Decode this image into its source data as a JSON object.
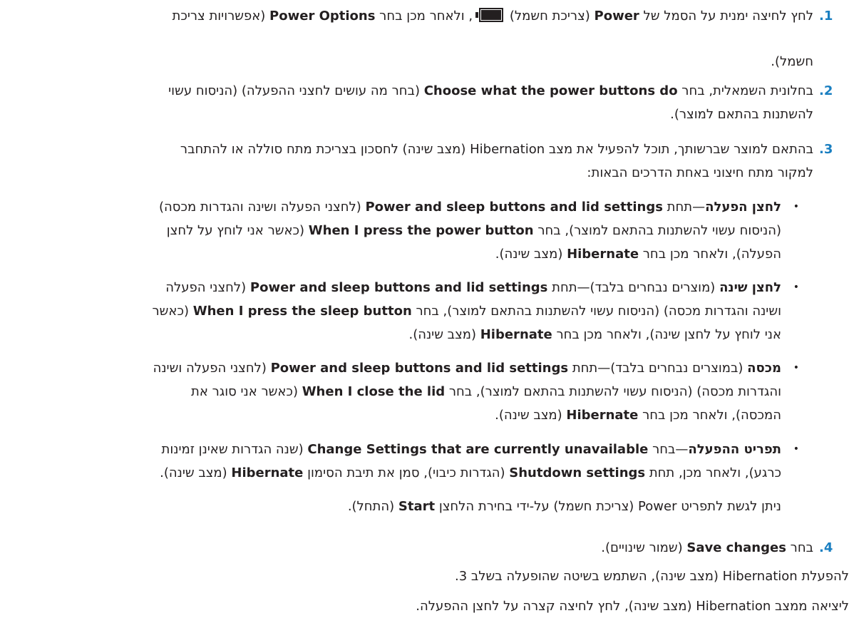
{
  "steps": [
    {
      "number": ".1",
      "lines": [
        {
          "parts": [
            "לחץ לחיצה ימנית על הסמל של ",
            "Power",
            " (צריכת חשמל) ",
            "",
            ", ולאחר מכן בחר ",
            "Power Options",
            " (אפשרויות צריכת"
          ]
        },
        {
          "parts": [
            "חשמל)."
          ]
        }
      ]
    },
    {
      "number": ".2",
      "lines": [
        {
          "parts": [
            "בחלונית השמאלית, בחר ",
            "Choose what the power buttons do",
            " (בחר מה עושים לחצני ההפעלה) (הניסוח עשוי"
          ]
        },
        {
          "parts": [
            "להשתנות בהתאם למוצר)."
          ]
        }
      ]
    },
    {
      "number": ".3",
      "lines": [
        {
          "parts": [
            "בהתאם למוצר שברשותך, תוכל להפעיל את מצב Hibernation (מצב שינה) לחסכון בצריכת מתח סוללה או להתחבר"
          ]
        },
        {
          "parts": [
            "למקור מתח חיצוני באחת הדרכים הבאות:"
          ]
        }
      ]
    },
    {
      "number": ".4",
      "lines": [
        {
          "parts": [
            "בחר ",
            "Save changes",
            " (שמור שינויים)."
          ]
        }
      ]
    }
  ],
  "bullets": [
    {
      "lines": [
        [
          "לחצן הפעלה",
          "—תחת ",
          "Power and sleep buttons and lid settings",
          " (לחצני הפעלה ושינה והגדרות מכסה)"
        ],
        [
          "(הניסוח עשוי להשתנות בהתאם למוצר), בחר ",
          "When I press the power button",
          " (כאשר אני לוחץ על לחצן"
        ],
        [
          "הפעלה), ולאחר מכן בחר ",
          "Hibernate",
          " (מצב שינה)."
        ]
      ]
    },
    {
      "lines": [
        [
          "לחצן שינה",
          " (מוצרים נבחרים בלבד)—תחת ",
          "Power and sleep buttons and lid settings",
          " (לחצני הפעלה"
        ],
        [
          "ושינה והגדרות מכסה) (הניסוח עשוי להשתנות בהתאם למוצר), בחר ",
          "When I press the sleep button",
          " (כאשר"
        ],
        [
          "אני לוחץ על לחצן שינה), ולאחר מכן בחר ",
          "Hibernate",
          " (מצב שינה)."
        ]
      ]
    },
    {
      "lines": [
        [
          "מכסה",
          " (במוצרים נבחרים בלבד)—תחת ",
          "Power and sleep buttons and lid settings",
          " (לחצני הפעלה ושינה"
        ],
        [
          "והגדרות מכסה) (הניסוח עשוי להשתנות בהתאם למוצר), בחר ",
          "When I close the lid",
          " (כאשר אני סוגר את"
        ],
        [
          "המכסה), ולאחר מכן בחר ",
          "Hibernate",
          " (מצב שינה)."
        ]
      ]
    },
    {
      "lines": [
        [
          "תפריט ההפעלה",
          "—בחר ",
          "Change Settings that are currently unavailable",
          " (שנה הגדרות שאינן זמינות"
        ],
        [
          "כרגע), ולאחר מכן, תחת ",
          "Shutdown settings",
          " (הגדרות כיבוי), סמן את תיבת הסימון ",
          "Hibernate",
          " (מצב שינה)."
        ]
      ]
    }
  ],
  "note": [
    "ניתן לגשת לתפריט Power (צריכת חשמל) על-ידי בחירת הלחצן ",
    "Start",
    " (התחל)."
  ],
  "paragraphs": [
    "להפעלת Hibernation (מצב שינה), השתמש בשיטה שהופעלה בשלב 3.",
    "ליציאה ממצב Hibernation (מצב שינה), לחץ לחיצה קצרה על לחצן ההפעלה."
  ],
  "icons": {
    "battery": "battery-icon",
    "bullet": "•"
  },
  "colors": {
    "step_number": "#1a7fc1",
    "text": "#231f20"
  }
}
